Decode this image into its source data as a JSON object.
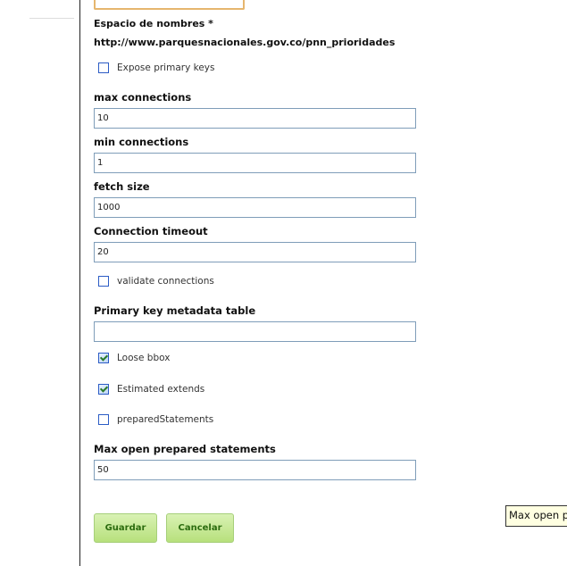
{
  "namespace": {
    "label": "Espacio de nombres *",
    "value": "http://www.parquesnacionales.gov.co/pnn_prioridades"
  },
  "checkboxes": {
    "expose_primary_keys": {
      "label": "Expose primary keys",
      "checked": false
    },
    "validate_connections": {
      "label": "validate connections",
      "checked": false
    },
    "loose_bbox": {
      "label": "Loose bbox",
      "checked": true
    },
    "estimated_extends": {
      "label": "Estimated extends",
      "checked": true
    },
    "prepared_statements": {
      "label": "preparedStatements",
      "checked": false
    }
  },
  "fields": {
    "max_connections": {
      "label": "max connections",
      "value": "10"
    },
    "min_connections": {
      "label": "min connections",
      "value": "1"
    },
    "fetch_size": {
      "label": "fetch size",
      "value": "1000"
    },
    "connection_timeout": {
      "label": "Connection timeout",
      "value": "20"
    },
    "pk_metadata_table": {
      "label": "Primary key metadata table",
      "value": ""
    },
    "max_open_prepared_statements": {
      "label": "Max open prepared statements",
      "value": "50"
    }
  },
  "buttons": {
    "save": "Guardar",
    "cancel": "Cancelar"
  },
  "tooltip": "Max open prepared statements",
  "colors": {
    "button_bg": "#c6e894",
    "button_text": "#2c6c10",
    "input_border": "#7f9db9",
    "checkbox_border": "#2c5cc5",
    "tooltip_bg": "#ffffe1"
  }
}
